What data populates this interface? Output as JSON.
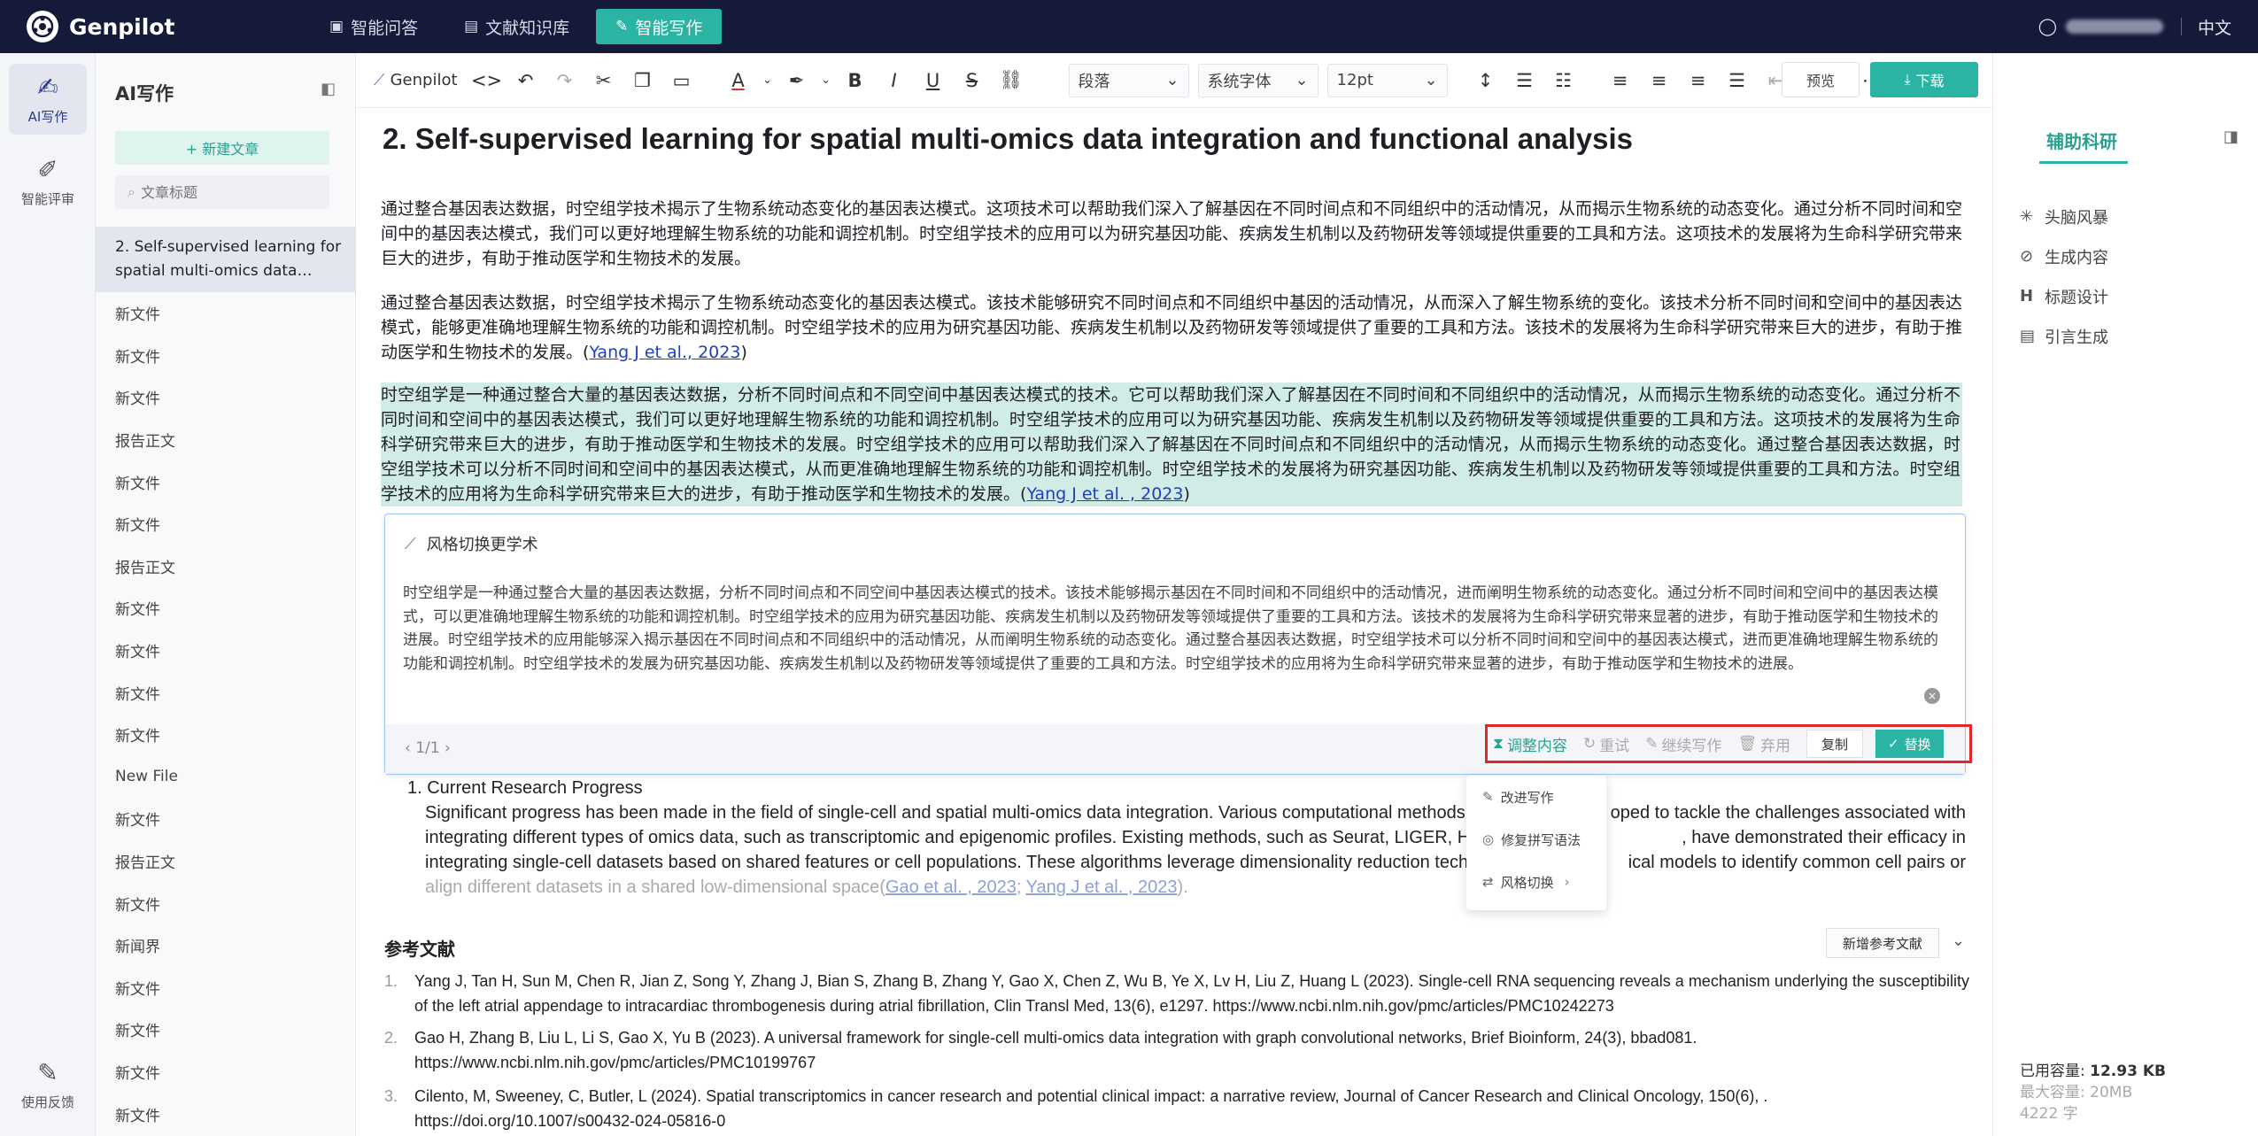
{
  "app": {
    "name": "Genpilot",
    "lang": "中文"
  },
  "nav": [
    {
      "label": "智能问答",
      "icon": "chat-icon"
    },
    {
      "label": "文献知识库",
      "icon": "book-icon"
    },
    {
      "label": "智能写作",
      "icon": "edit-icon"
    }
  ],
  "rail": [
    {
      "label": "AI写作"
    },
    {
      "label": "智能评审"
    },
    {
      "label": "使用反馈"
    }
  ],
  "sidebar": {
    "title": "AI写作",
    "new_label": "+ 新建文章",
    "search_placeholder": "文章标题",
    "items": [
      "2. Self-supervised learning for spatial multi-omics data…",
      "新文件",
      "新文件",
      "新文件",
      "报告正文",
      "新文件",
      "新文件",
      "报告正文",
      "新文件",
      "新文件",
      "新文件",
      "新文件",
      "New File",
      "新文件",
      "报告正文",
      "新文件",
      "新闻界",
      "新文件",
      "新文件",
      "新文件",
      "新文件"
    ]
  },
  "toolbar": {
    "genpilot": "Genpilot",
    "paragraph": "段落",
    "font": "系统字体",
    "size": "12pt",
    "preview": "预览",
    "download": "下载"
  },
  "doc": {
    "title": "2. Self-supervised learning for spatial multi-omics data integration and functional analysis",
    "p1": "通过整合基因表达数据，时空组学技术揭示了生物系统动态变化的基因表达模式。这项技术可以帮助我们深入了解基因在不同时间点和不同组织中的活动情况，从而揭示生物系统的动态变化。通过分析不同时间和空间中的基因表达模式，我们可以更好地理解生物系统的功能和调控机制。时空组学技术的应用可以为研究基因功能、疾病发生机制以及药物研发等领域提供重要的工具和方法。这项技术的发展将为生命科学研究带来巨大的进步，有助于推动医学和生物技术的发展。",
    "p2": "通过整合基因表达数据，时空组学技术揭示了生物系统动态变化的基因表达模式。该技术能够研究不同时间点和不同组织中基因的活动情况，从而深入了解生物系统的变化。该技术分析不同时间和空间中的基因表达模式，能够更准确地理解生物系统的功能和调控机制。时空组学技术的应用为研究基因功能、疾病发生机制以及药物研发等领域提供了重要的工具和方法。该技术的发展将为生命科学研究带来巨大的进步，有助于推动医学和生物技术的发展。",
    "p2_cite": "Yang J et al., 2023",
    "p3": "时空组学是一种通过整合大量的基因表达数据，分析不同时间点和不同空间中基因表达模式的技术。它可以帮助我们深入了解基因在不同时间和不同组织中的活动情况，从而揭示生物系统的动态变化。通过分析不同时间和空间中的基因表达模式，我们可以更好地理解生物系统的功能和调控机制。时空组学技术的应用可以为研究基因功能、疾病发生机制以及药物研发等领域提供重要的工具和方法。这项技术的发展将为生命科学研究带来巨大的进步，有助于推动医学和生物技术的发展。时空组学技术的应用可以帮助我们深入了解基因在不同时间点和不同组织中的活动情况，从而揭示生物系统的动态变化。通过整合基因表达数据，时空组学技术可以分析不同时间和空间中的基因表达模式，从而更准确地理解生物系统的功能和调控机制。时空组学技术的发展将为研究基因功能、疾病发生机制以及药物研发等领域提供重要的工具和方法。时空组学技术的应用将为生命科学研究带来巨大的进步，有助于推动医学和生物技术的发展。",
    "p3_cite": "Yang J et al. , 2023"
  },
  "panel": {
    "title": "风格切换更学术",
    "body": "时空组学是一种通过整合大量的基因表达数据，分析不同时间点和不同空间中基因表达模式的技术。该技术能够揭示基因在不同时间和不同组织中的活动情况，进而阐明生物系统的动态变化。通过分析不同时间和空间中的基因表达模式，可以更准确地理解生物系统的功能和调控机制。时空组学技术的应用为研究基因功能、疾病发生机制以及药物研发等领域提供了重要的工具和方法。该技术的发展将为生命科学研究带来显著的进步，有助于推动医学和生物技术的进展。时空组学技术的应用能够深入揭示基因在不同时间点和不同组织中的活动情况，从而阐明生物系统的动态变化。通过整合基因表达数据，时空组学技术可以分析不同时间和空间中的基因表达模式，进而更准确地理解生物系统的功能和调控机制。时空组学技术的发展为研究基因功能、疾病发生机制以及药物研发等领域提供了重要的工具和方法。时空组学技术的应用将为生命科学研究带来显著的进步，有助于推动医学和生物技术的进展。",
    "pager": "1/1",
    "adjust": "调整内容",
    "retry": "重试",
    "continue": "继续写作",
    "discard": "弃用",
    "copy": "复制",
    "replace": "替换"
  },
  "dropdown": [
    {
      "label": "改进写作",
      "icon": "pencil-icon"
    },
    {
      "label": "修复拼写语法",
      "icon": "spellcheck-icon"
    },
    {
      "label": "风格切换",
      "icon": "swap-icon"
    }
  ],
  "section": {
    "heading": "1. Current Research Progress",
    "line1a": "Significant progress has been made in the field of single-cell and spatial multi-omics data integration. Various computational methods",
    "line1b": "oped to tackle the challenges associated with",
    "line2": "integrating different types of omics data, such as transcriptomic and epigenomic profiles. Existing methods, such as Seurat, LIGER, Har",
    "line2b": ", have demonstrated their efficacy in",
    "line3": "integrating single-cell datasets based on shared features or cell populations. These algorithms leverage dimensionality reduction techn",
    "line3b": "ical models to identify common cell pairs or",
    "line4": "align different datasets in a shared low-dimensional space(",
    "cite1": "Gao et al. , 2023",
    "cite2": "Yang J et al. , 2023"
  },
  "refs": {
    "title": "参考文献",
    "add": "新增参考文献",
    "items": [
      {
        "num": "1.",
        "text": "Yang J, Tan H, Sun M, Chen R, Jian Z, Song Y, Zhang J, Bian S, Zhang B, Zhang Y, Gao X, Chen Z, Wu B, Ye X, Lv H, Liu Z, Huang L (2023). Single-cell RNA sequencing reveals a mechanism underlying the susceptibility of the left atrial appendage to intracardiac thrombogenesis during atrial fibrillation, Clin Transl Med, 13(6), e1297. https://www.ncbi.nlm.nih.gov/pmc/articles/PMC10242273"
      },
      {
        "num": "2.",
        "text": "Gao H, Zhang B, Liu L, Li S, Gao X, Yu B (2023). A universal framework for single-cell multi-omics data integration with graph convolutional networks, Brief Bioinform, 24(3), bbad081. https://www.ncbi.nlm.nih.gov/pmc/articles/PMC10199767"
      },
      {
        "num": "3.",
        "text": "Cilento, M, Sweeney, C, Butler, L (2024). Spatial transcriptomics in cancer research and potential clinical impact: a narrative review, Journal of Cancer Research and Clinical Oncology, 150(6), . https://doi.org/10.1007/s00432-024-05816-0"
      }
    ]
  },
  "right": {
    "tab": "辅助科研",
    "items": [
      {
        "label": "头脑风暴",
        "icon": "sparkle-icon"
      },
      {
        "label": "生成内容",
        "icon": "check-circle-icon"
      },
      {
        "label": "标题设计",
        "icon": "heading-icon"
      },
      {
        "label": "引言生成",
        "icon": "document-icon"
      }
    ],
    "used_label": "已用容量:",
    "used": "12.93 KB",
    "max_label": "最大容量:",
    "max": "20MB",
    "chars": "4222 字"
  }
}
